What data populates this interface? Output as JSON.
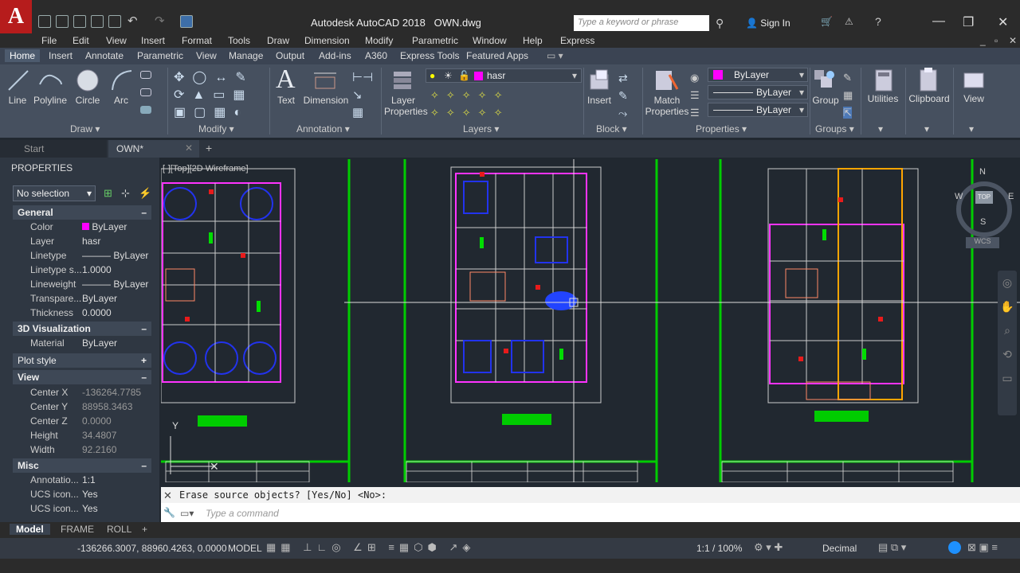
{
  "app": {
    "title": "Autodesk AutoCAD 2018",
    "filename": "OWN.dwg",
    "search_placeholder": "Type a keyword or phrase",
    "sign_in": "Sign In"
  },
  "menus": [
    "File",
    "Edit",
    "View",
    "Insert",
    "Format",
    "Tools",
    "Draw",
    "Dimension",
    "Modify",
    "Parametric",
    "Window",
    "Help",
    "Express"
  ],
  "ribbon_tabs": [
    "Home",
    "Insert",
    "Annotate",
    "Parametric",
    "View",
    "Manage",
    "Output",
    "Add-ins",
    "A360",
    "Express Tools",
    "Featured Apps"
  ],
  "draw": {
    "line": "Line",
    "polyline": "Polyline",
    "circle": "Circle",
    "arc": "Arc",
    "panel": "Draw"
  },
  "modify": {
    "panel": "Modify"
  },
  "annotation": {
    "text": "Text",
    "dimension": "Dimension",
    "panel": "Annotation"
  },
  "layers": {
    "layer_properties": "Layer\nProperties",
    "current_layer": "hasr",
    "panel": "Layers"
  },
  "block": {
    "insert": "Insert",
    "panel": "Block"
  },
  "properties_panel": {
    "match": "Match\nProperties",
    "color": "ByLayer",
    "linetype": "ByLayer",
    "lineweight": "ByLayer",
    "panel": "Properties"
  },
  "groups": {
    "group": "Group",
    "panel": "Groups"
  },
  "utilities": "Utilities",
  "clipboard": "Clipboard",
  "view": "View",
  "file_tabs": {
    "start": "Start",
    "current": "OWN*"
  },
  "properties": {
    "title": "PROPERTIES",
    "selection": "No selection",
    "general": "General",
    "color_label": "Color",
    "color": "ByLayer",
    "layer_label": "Layer",
    "layer": "hasr",
    "linetype_label": "Linetype",
    "linetype": "ByLayer",
    "ltscale_label": "Linetype s...",
    "ltscale": "1.0000",
    "lineweight_label": "Lineweight",
    "lineweight": "ByLayer",
    "transparency_label": "Transpare...",
    "transparency": "ByLayer",
    "thickness_label": "Thickness",
    "thickness": "0.0000",
    "viz3d": "3D Visualization",
    "material_label": "Material",
    "material": "ByLayer",
    "plot_style": "Plot style",
    "view": "View",
    "cx_label": "Center X",
    "cx": "-136264.7785",
    "cy_label": "Center Y",
    "cy": "88958.3463",
    "cz_label": "Center Z",
    "cz": "0.0000",
    "h_label": "Height",
    "h": "34.4807",
    "w_label": "Width",
    "w": "92.2160",
    "misc": "Misc",
    "anno_label": "Annotatio...",
    "anno": "1:1",
    "ucs1_label": "UCS icon...",
    "ucs1": "Yes",
    "ucs2_label": "UCS icon...",
    "ucs2": "Yes"
  },
  "viewport": {
    "label": "[-][Top][2D Wireframe]",
    "compass": {
      "n": "N",
      "s": "S",
      "e": "E",
      "w": "W",
      "top": "TOP",
      "wcs": "WCS"
    },
    "y_axis": "Y"
  },
  "command": {
    "history": "Erase source objects? [Yes/No] <No>:",
    "placeholder": "Type a command"
  },
  "layout_tabs": [
    "Model",
    "FRAME",
    "ROLL"
  ],
  "status": {
    "coords": "-136266.3007, 88960.4263, 0.0000",
    "space": "MODEL",
    "scale": "1:1 / 100%",
    "units": "Decimal"
  },
  "colors": {
    "accent": "#1e90ff",
    "wall": "#ff33ff",
    "grid_green": "#00dd00",
    "column_red": "#e81b1b",
    "door_blue": "#2222dd"
  }
}
